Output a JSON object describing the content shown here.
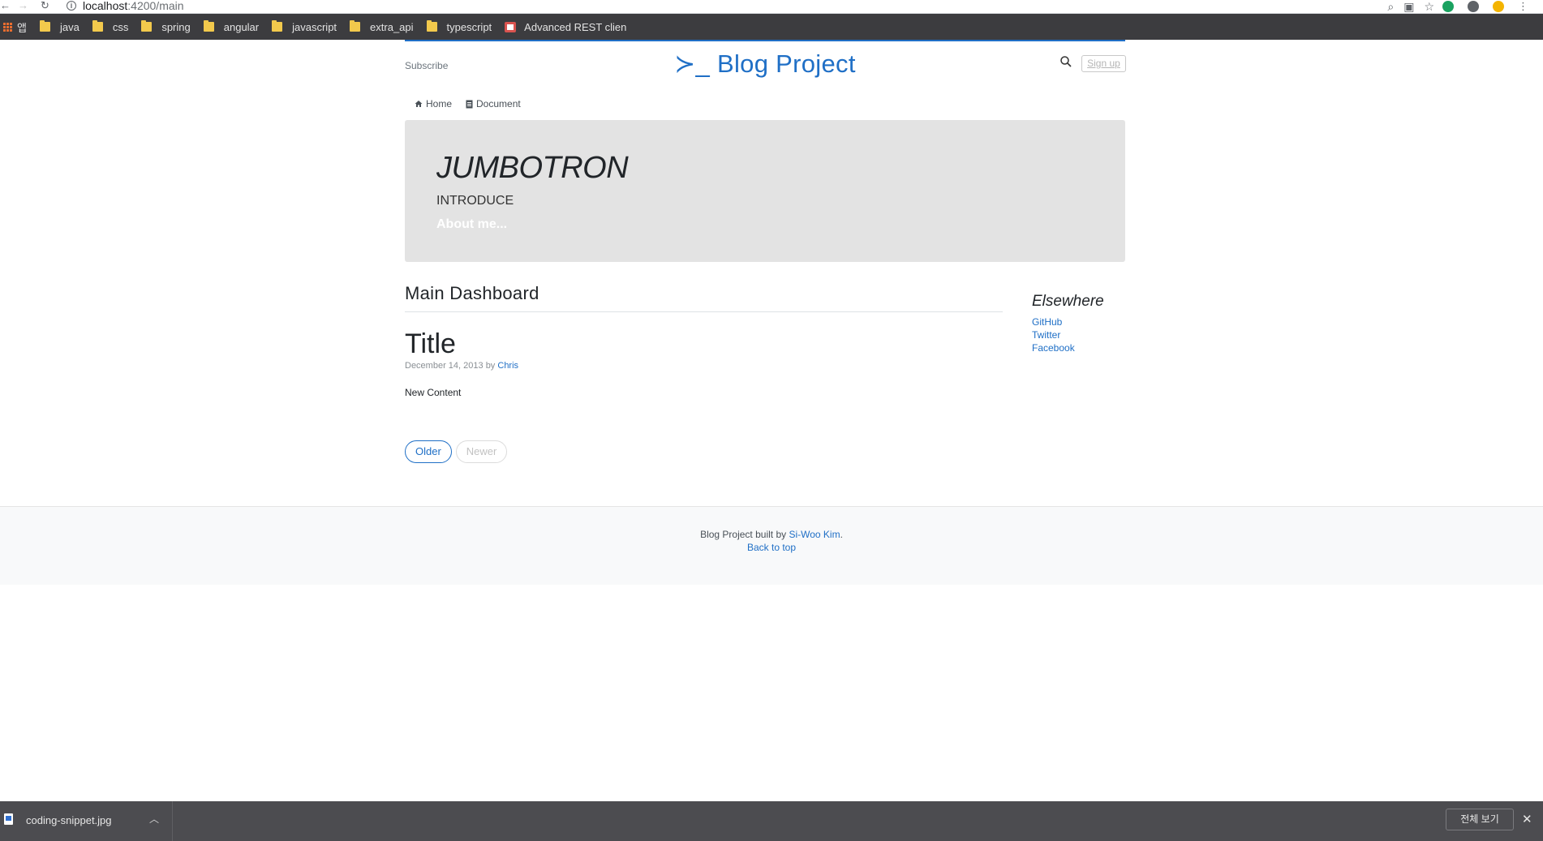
{
  "browser": {
    "url_host": "localhost",
    "url_path": ":4200/main",
    "bookmarks": [
      {
        "label": "앱",
        "kind": "apps"
      },
      {
        "label": "java",
        "kind": "folder"
      },
      {
        "label": "css",
        "kind": "folder"
      },
      {
        "label": "spring",
        "kind": "folder"
      },
      {
        "label": "angular",
        "kind": "folder"
      },
      {
        "label": "javascript",
        "kind": "folder"
      },
      {
        "label": "extra_api",
        "kind": "folder"
      },
      {
        "label": "typescript",
        "kind": "folder"
      },
      {
        "label": "Advanced REST clien",
        "kind": "app"
      }
    ]
  },
  "header": {
    "subscribe": "Subscribe",
    "brand": "≻_ Blog Project",
    "signup": "Sign up"
  },
  "nav": {
    "home": "Home",
    "document": "Document"
  },
  "jumbotron": {
    "title": "JUMBOTRON",
    "intro": "INTRODUCE",
    "about": "About me..."
  },
  "main": {
    "heading": "Main Dashboard",
    "post": {
      "title": "Title",
      "date": "December 14, 2013",
      "by": "by",
      "author": "Chris",
      "body": "New Content"
    },
    "pager": {
      "older": "Older",
      "newer": "Newer"
    }
  },
  "aside": {
    "heading": "Elsewhere",
    "links": [
      "GitHub",
      "Twitter",
      "Facebook"
    ]
  },
  "footer": {
    "prefix": "Blog Project built by",
    "author": "Si-Woo Kim",
    "suffix": ".",
    "back_to_top": "Back to top"
  },
  "downloads": {
    "file": "coding-snippet.jpg",
    "show_all": "전체 보기"
  },
  "colors": {
    "accent": "#1f6fc6",
    "jumbotron_bg": "#e3e3e3",
    "bookmark_bar": "#3c3c3f",
    "shelf": "#4c4c50"
  }
}
